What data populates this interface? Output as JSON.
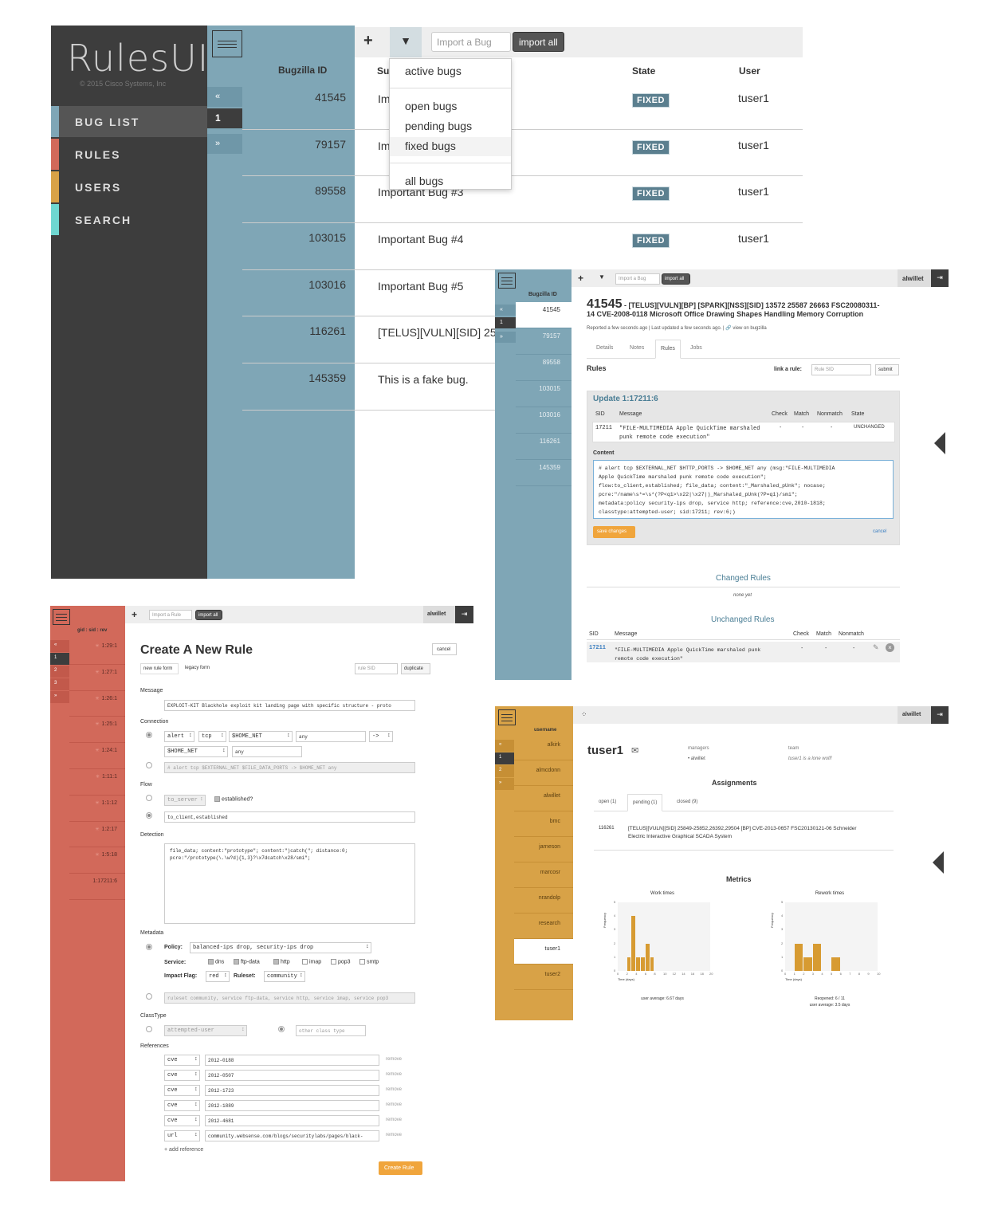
{
  "colors": {
    "sidebar": "#3d3d3d",
    "blue": "#7fa6b6",
    "red": "#d2695a",
    "orange": "#d8a247",
    "accent_orange": "#f0a53c"
  },
  "main": {
    "logo": "RulesUI",
    "copyright": "© 2015 Cisco Systems, Inc",
    "nav": [
      {
        "label": "BUG LIST",
        "color": "#7fa6b6"
      },
      {
        "label": "RULES",
        "color": "#d2695a"
      },
      {
        "label": "USERS",
        "color": "#d8a247"
      },
      {
        "label": "SEARCH",
        "color": "#6fd7d1"
      }
    ],
    "col_bugzilla": "Bugzilla ID",
    "col_summary": "Su",
    "col_state": "State",
    "col_user": "User",
    "pager": [
      "«",
      "1",
      "»"
    ],
    "import_placeholder": "Import a Bug",
    "import_all": "import all",
    "filter_menu": [
      "active bugs",
      "open bugs",
      "pending bugs",
      "fixed bugs",
      "all bugs"
    ],
    "rows": [
      {
        "id": "41545",
        "summary": "Im",
        "state": "FIXED",
        "user": "tuser1"
      },
      {
        "id": "79157",
        "summary": "Im",
        "state": "FIXED",
        "user": "tuser1"
      },
      {
        "id": "89558",
        "summary": "Important Bug #3",
        "state": "FIXED",
        "user": "tuser1"
      },
      {
        "id": "103015",
        "summary": "Important Bug #4",
        "state": "FIXED",
        "user": "tuser1"
      },
      {
        "id": "103016",
        "summary": "Important Bug #5",
        "state": "",
        "user": ""
      },
      {
        "id": "116261",
        "summary": "[TELUS][VULN][SID] 25",
        "state": "",
        "user": ""
      },
      {
        "id": "145359",
        "summary": "This is a fake bug.",
        "state": "",
        "user": ""
      }
    ]
  },
  "detail": {
    "col": "Bugzilla ID",
    "ids": [
      "41545",
      "79157",
      "89558",
      "103015",
      "103016",
      "116261",
      "145359"
    ],
    "pager": [
      "«",
      "1",
      "»"
    ],
    "import_placeholder": "Import a Bug",
    "import_all": "import all",
    "user": "alwillet",
    "bug_id": "41545",
    "title_rest": " - [TELUS][VULN][BP] [SPARK][NSS][SID] 13572 25587 26663 FSC20080311-",
    "title_line2": "14 CVE-2008-0118 Microsoft Office Drawing Shapes Handling Memory Corruption",
    "meta": "Reported a few seconds ago | Last updated a few seconds ago. | 🔗 view on bugzilla",
    "tabs": [
      "Details",
      "Notes",
      "Rules",
      "Jobs"
    ],
    "rules_heading": "Rules",
    "link_label": "link a rule:",
    "rule_sid_placeholder": "Rule SID",
    "submit": "submit",
    "update_title": "Update 1:17211:6",
    "cols": [
      "SID",
      "Message",
      "Check",
      "Match",
      "Nonmatch",
      "State"
    ],
    "row": {
      "sid": "17211",
      "msg1": "\"FILE-MULTIMEDIA Apple QuickTime marshaled",
      "msg2": "punk remote code execution\"",
      "check": "-",
      "match": "-",
      "nonmatch": "-",
      "state": "UNCHANGED"
    },
    "content_label": "Content",
    "content": [
      "# alert tcp $EXTERNAL_NET $HTTP_PORTS -> $HOME_NET any (msg:\"FILE-MULTIMEDIA",
      "Apple QuickTime marshaled punk remote code execution\";",
      "flow:to_client,established; file_data; content:\"_Marshaled_pUnk\"; nocase;",
      "pcre:\"/name\\s*=\\s*(?P<q1>\\x22|\\x27|)_Marshaled_pUnk(?P=q1)/smi\";",
      "metadata:policy security-ips drop, service http; reference:cve,2010-1818;",
      "classtype:attempted-user; sid:17211; rev:6;)"
    ],
    "save": "save changes",
    "cancel": "cancel",
    "changed": "Changed Rules",
    "none_yet": "none yet",
    "unchanged": "Unchanged Rules",
    "ucols": [
      "SID",
      "Message",
      "Check",
      "Match",
      "Nonmatch"
    ],
    "urow": {
      "sid": "17211",
      "msg1": "\"FILE-MULTIMEDIA Apple QuickTime marshaled punk",
      "msg2": "remote code execution\"",
      "check": "-",
      "match": "-",
      "nonmatch": "-"
    }
  },
  "rule": {
    "col": "gid : sid : rev",
    "items": [
      "1:29:1",
      "1:27:1",
      "1:26:1",
      "1:25:1",
      "1:24:1",
      "1:11:1",
      "1:1:12",
      "1:2:17",
      "1:5:18",
      "1:17211:6"
    ],
    "pager": [
      "«",
      "1",
      "2",
      "3",
      "»"
    ],
    "import_placeholder": "Import a Rule",
    "import_all": "import all",
    "user": "alwillet",
    "title": "Create A New Rule",
    "cancel": "cancel",
    "tabs": [
      "new rule form",
      "legacy form"
    ],
    "sid_placeholder": "rule SID",
    "duplicate": "duplicate",
    "message_label": "Message",
    "message": "EXPLOIT-KIT Blackhole exploit kit landing page with specific structure - proto",
    "connection_label": "Connection",
    "conn": [
      "alert",
      "tcp",
      "$HOME_NET",
      "any",
      "->",
      "$HOME_NET",
      "any"
    ],
    "conn_raw": "# alert tcp $EXTERNAL_NET $FILE_DATA_PORTS -> $HOME_NET any",
    "flow_label": "Flow",
    "flow_sel": "to_server",
    "established": "established?",
    "flow_raw": "to_client,established",
    "detection_label": "Detection",
    "detection": [
      "file_data; content:\"prototype\"; content:\")catch(\"; distance:0;",
      "pcre:\"/prototype(\\.\\w?d){1,3}?\\x7dcatch\\x28/smi\";"
    ],
    "metadata_label": "Metadata",
    "policy_label": "Policy:",
    "policy": "balanced-ips drop, security-ips drop",
    "service_label": "Service:",
    "services": [
      "dns",
      "ftp-data",
      "http",
      "imap",
      "pop3",
      "smtp"
    ],
    "impact_label": "Impact Flag:",
    "impact": "red",
    "ruleset_label": "Ruleset:",
    "ruleset": "community",
    "meta_raw": "ruleset community, service ftp-data, service http, service imap, service pop3",
    "classtype_label": "ClassType",
    "classtype": "attempted-user",
    "other_class": "other class type",
    "references_label": "References",
    "refs": [
      {
        "t": "cve",
        "v": "2012-0188"
      },
      {
        "t": "cve",
        "v": "2012-0507"
      },
      {
        "t": "cve",
        "v": "2012-1723"
      },
      {
        "t": "cve",
        "v": "2012-1889"
      },
      {
        "t": "cve",
        "v": "2012-4681"
      },
      {
        "t": "url",
        "v": "community.websense.com/blogs/securitylabs/pages/black-"
      }
    ],
    "remove": "remove",
    "add_ref": "+ add reference",
    "create": "Create Rule"
  },
  "users": {
    "col": "username",
    "names": [
      "alkirk",
      "almcdonn",
      "alwillet",
      "bmc",
      "jarneson",
      "marcosr",
      "nrandolp",
      "research",
      "tuser1",
      "tuser2"
    ],
    "pager": [
      "«",
      "1",
      "2",
      "»"
    ],
    "user": "alwillet",
    "name": "tuser1",
    "managers_label": "managers",
    "manager": "alwillet",
    "team_label": "team",
    "team": "tuser1 is a lone wolf!",
    "assignments": "Assignments",
    "tabs": [
      "open (1)",
      "pending (1)",
      "closed (9)"
    ],
    "assign_id": "116261",
    "assign_text1": "[TELUS][VULN][SID] 25849-25852,26392,29504 [BP] CVE-2013-0657 FSC20130121-06 Schneider",
    "assign_text2": "Electric Interactive Graphical SCADA System",
    "metrics": "Metrics"
  },
  "chart_data": [
    {
      "type": "bar",
      "title": "Work times",
      "xlabel": "Time (days)",
      "ylabel": "Frequency",
      "ylim": [
        0,
        5
      ],
      "x": [
        0,
        2,
        4,
        6,
        8,
        10,
        12,
        14,
        16,
        18,
        20
      ],
      "values": [
        0,
        0,
        1,
        4,
        1,
        1,
        2,
        1,
        0,
        0,
        0,
        0,
        0,
        0,
        0,
        0,
        0,
        0,
        0,
        0
      ],
      "footer": "user average: 6.67 days"
    },
    {
      "type": "bar",
      "title": "Rework times",
      "xlabel": "Time (days)",
      "ylabel": "Frequency",
      "ylim": [
        0,
        5
      ],
      "x": [
        0,
        1,
        2,
        3,
        4,
        5,
        6,
        7,
        8,
        9,
        10
      ],
      "values": [
        0,
        2,
        1,
        2,
        0,
        1,
        0,
        0,
        0,
        0
      ],
      "footer1": "Reopened: 6 / 11",
      "footer2": "user average: 3.5 days"
    }
  ]
}
